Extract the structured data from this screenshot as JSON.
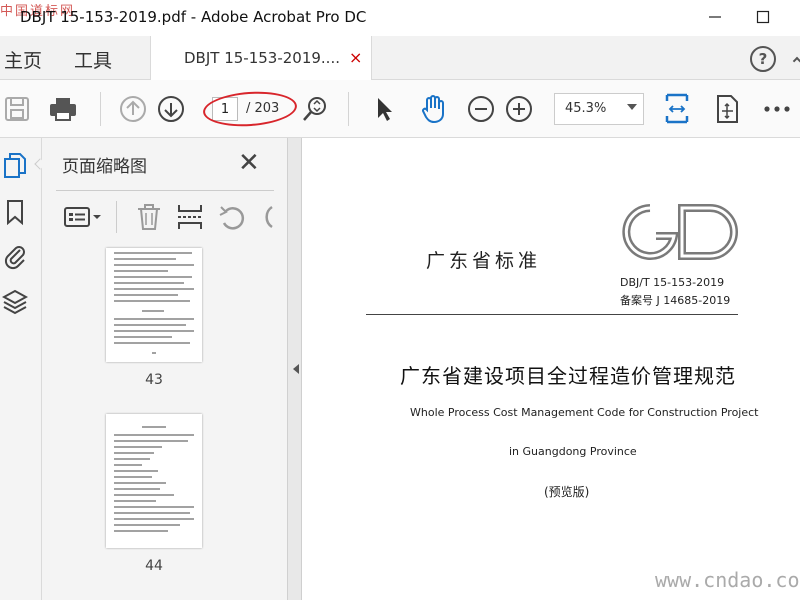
{
  "window": {
    "title": "DBJT 15-153-2019.pdf - Adobe Acrobat Pro DC",
    "watermark_top": "中国道标网",
    "minimize": "—",
    "maximize": "☐"
  },
  "tabs": {
    "home": "主页",
    "tools": "工具",
    "document": "DBJT 15-153-2019....",
    "document_close": "×",
    "help": "?"
  },
  "toolbar": {
    "page_current": "1",
    "page_total": "/ 203",
    "zoom": "45.3%"
  },
  "thumbnails": {
    "title": "页面缩略图",
    "close": "✕",
    "pages": [
      {
        "label": "43"
      },
      {
        "label": "44"
      }
    ]
  },
  "document": {
    "standard_org": "广东省标准",
    "standard_code": "DBJ/T 15-153-2019",
    "record_number": "备案号  J 14685-2019",
    "title_cn": "广东省建设项目全过程造价管理规范",
    "title_en_line1": "Whole Process Cost Management Code for Construction Project",
    "title_en_line2": "in Guangdong Province",
    "edition": "(预览版)"
  },
  "watermark_bottom": "www.cndao.com",
  "colors": {
    "highlight_oval": "#d8252b",
    "accent_blue": "#1a73c7"
  }
}
